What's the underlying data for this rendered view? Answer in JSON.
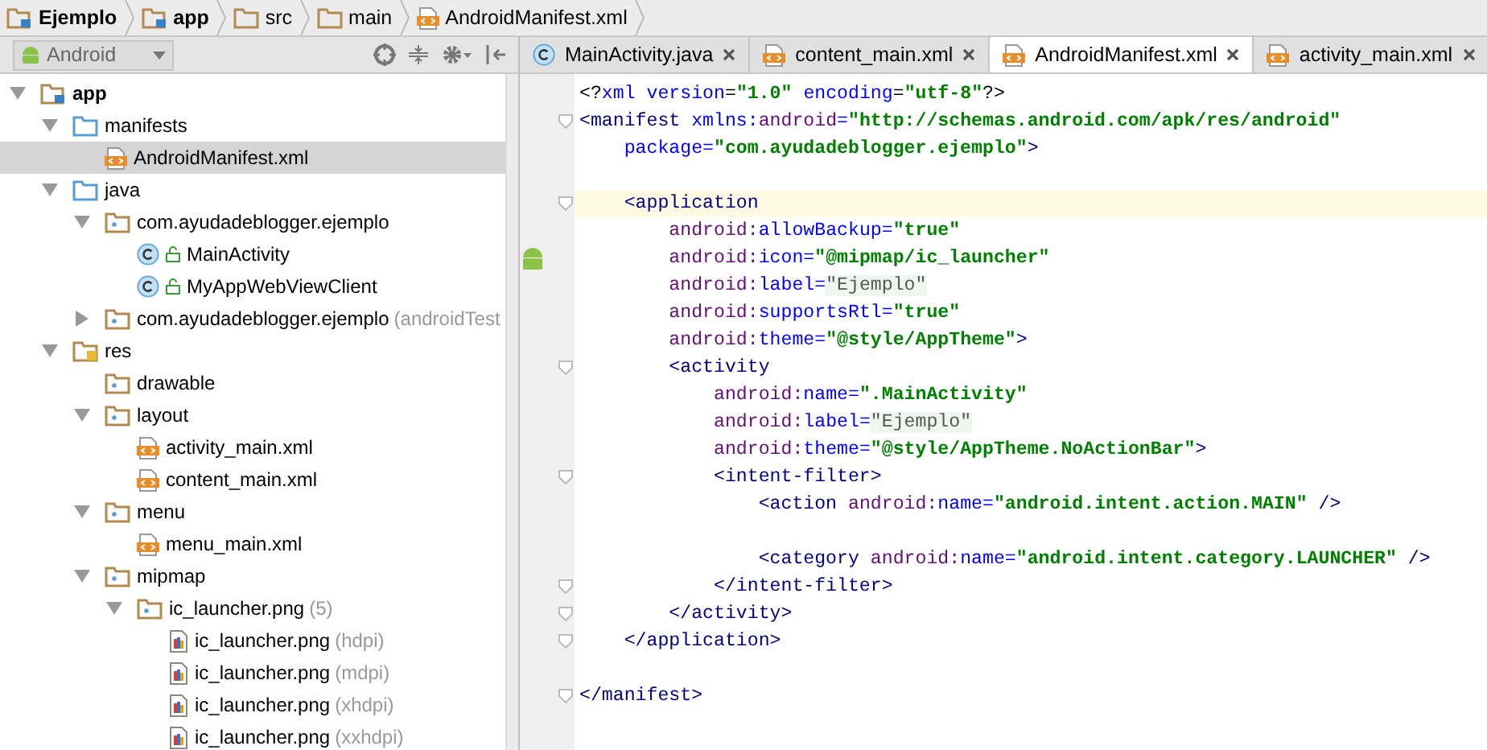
{
  "breadcrumbs": [
    {
      "label": "Ejemplo",
      "kind": "module"
    },
    {
      "label": "app",
      "kind": "module"
    },
    {
      "label": "src",
      "kind": "folder"
    },
    {
      "label": "main",
      "kind": "folder"
    },
    {
      "label": "AndroidManifest.xml",
      "kind": "xml"
    }
  ],
  "project_view": {
    "selector": "Android"
  },
  "tree": [
    {
      "label": "app",
      "kind": "module",
      "expanded": true,
      "selected": false,
      "children": [
        {
          "label": "manifests",
          "kind": "source-folder",
          "expanded": true,
          "selected": false,
          "children": [
            {
              "label": "AndroidManifest.xml",
              "kind": "xml",
              "selected": true
            }
          ]
        },
        {
          "label": "java",
          "kind": "source-folder",
          "expanded": true,
          "selected": false,
          "children": [
            {
              "label": "com.ayudadeblogger.ejemplo",
              "kind": "package",
              "expanded": true,
              "selected": false,
              "children": [
                {
                  "label": "MainActivity",
                  "kind": "class",
                  "selected": false
                },
                {
                  "label": "MyAppWebViewClient",
                  "kind": "class",
                  "selected": false
                }
              ]
            },
            {
              "label": "com.ayudadeblogger.ejemplo",
              "hint": "(androidTest",
              "kind": "package",
              "expanded": false,
              "selected": false
            }
          ]
        },
        {
          "label": "res",
          "kind": "res",
          "expanded": true,
          "selected": false,
          "children": [
            {
              "label": "drawable",
              "kind": "package",
              "selected": false
            },
            {
              "label": "layout",
              "kind": "package",
              "expanded": true,
              "selected": false,
              "children": [
                {
                  "label": "activity_main.xml",
                  "kind": "xml",
                  "selected": false
                },
                {
                  "label": "content_main.xml",
                  "kind": "xml",
                  "selected": false
                }
              ]
            },
            {
              "label": "menu",
              "kind": "package",
              "expanded": true,
              "selected": false,
              "children": [
                {
                  "label": "menu_main.xml",
                  "kind": "xml",
                  "selected": false
                }
              ]
            },
            {
              "label": "mipmap",
              "kind": "package",
              "expanded": true,
              "selected": false,
              "children": [
                {
                  "label": "ic_launcher.png",
                  "hint": "(5)",
                  "kind": "package",
                  "expanded": true,
                  "selected": false,
                  "children": [
                    {
                      "label": "ic_launcher.png",
                      "hint": "(hdpi)",
                      "kind": "image",
                      "selected": false
                    },
                    {
                      "label": "ic_launcher.png",
                      "hint": "(mdpi)",
                      "kind": "image",
                      "selected": false
                    },
                    {
                      "label": "ic_launcher.png",
                      "hint": "(xhdpi)",
                      "kind": "image",
                      "selected": false
                    },
                    {
                      "label": "ic_launcher.png",
                      "hint": "(xxhdpi)",
                      "kind": "image",
                      "selected": false
                    }
                  ]
                }
              ]
            }
          ]
        }
      ]
    }
  ],
  "tabs": [
    {
      "label": "MainActivity.java",
      "kind": "class",
      "selected": false
    },
    {
      "label": "content_main.xml",
      "kind": "xml",
      "selected": false
    },
    {
      "label": "AndroidManifest.xml",
      "kind": "xml",
      "selected": true
    },
    {
      "label": "activity_main.xml",
      "kind": "xml",
      "selected": false
    }
  ],
  "code_lines": [
    {
      "current": false,
      "kind": "plain",
      "tokens": [
        {
          "kind": "punct",
          "text": "<?"
        },
        {
          "kind": "attr",
          "text": "xml "
        },
        {
          "kind": "attr",
          "text": "version"
        },
        {
          "kind": "punct",
          "text": "="
        },
        {
          "kind": "value",
          "text": "\"1.0\" "
        },
        {
          "kind": "attr",
          "text": "encoding"
        },
        {
          "kind": "punct",
          "text": "="
        },
        {
          "kind": "value",
          "text": "\"utf-8\""
        },
        {
          "kind": "punct",
          "text": "?>"
        }
      ]
    },
    {
      "current": false,
      "kind": "fold",
      "tokens": [
        {
          "kind": "tag",
          "text": "<manifest "
        },
        {
          "kind": "attr",
          "text": "xmlns:"
        },
        {
          "kind": "ns",
          "text": "android"
        },
        {
          "kind": "attr",
          "text": "="
        },
        {
          "kind": "value",
          "text": "\"http://schemas.android.com/apk/res/android\""
        }
      ]
    },
    {
      "current": false,
      "kind": "plain",
      "tokens": [
        {
          "kind": "attr",
          "text": "    package"
        },
        {
          "kind": "attr",
          "text": "="
        },
        {
          "kind": "value",
          "text": "\"com.ayudadeblogger.ejemplo\""
        },
        {
          "kind": "tag",
          "text": ">"
        }
      ]
    },
    {
      "current": false,
      "kind": "plain"
    },
    {
      "current": true,
      "kind": "fold",
      "tokens": [
        {
          "kind": "tag",
          "text": "    <application"
        }
      ]
    },
    {
      "current": false,
      "kind": "plain",
      "tokens": [
        {
          "kind": "ns",
          "text": "        android:"
        },
        {
          "kind": "attr",
          "text": "allowBackup"
        },
        {
          "kind": "attr",
          "text": "="
        },
        {
          "kind": "value",
          "text": "\"true\""
        }
      ]
    },
    {
      "current": false,
      "kind": "android",
      "tokens": [
        {
          "kind": "ns",
          "text": "        android:"
        },
        {
          "kind": "attr",
          "text": "icon"
        },
        {
          "kind": "attr",
          "text": "="
        },
        {
          "kind": "value",
          "text": "\"@mipmap/ic_launcher\""
        }
      ]
    },
    {
      "current": false,
      "kind": "plain",
      "tokens": [
        {
          "kind": "ns",
          "text": "        android:"
        },
        {
          "kind": "attr",
          "text": "label"
        },
        {
          "kind": "attr",
          "text": "="
        },
        {
          "kind": "folded",
          "text": "\"Ejemplo\""
        }
      ]
    },
    {
      "current": false,
      "kind": "plain",
      "tokens": [
        {
          "kind": "ns",
          "text": "        android:"
        },
        {
          "kind": "attr",
          "text": "supportsRtl"
        },
        {
          "kind": "attr",
          "text": "="
        },
        {
          "kind": "value",
          "text": "\"true\""
        }
      ]
    },
    {
      "current": false,
      "kind": "plain",
      "tokens": [
        {
          "kind": "ns",
          "text": "        android:"
        },
        {
          "kind": "attr",
          "text": "theme"
        },
        {
          "kind": "attr",
          "text": "="
        },
        {
          "kind": "value",
          "text": "\"@style/AppTheme\""
        },
        {
          "kind": "tag",
          "text": ">"
        }
      ]
    },
    {
      "current": false,
      "kind": "fold",
      "tokens": [
        {
          "kind": "tag",
          "text": "        <activity"
        }
      ]
    },
    {
      "current": false,
      "kind": "plain",
      "tokens": [
        {
          "kind": "ns",
          "text": "            android:"
        },
        {
          "kind": "attr",
          "text": "name"
        },
        {
          "kind": "attr",
          "text": "="
        },
        {
          "kind": "value",
          "text": "\".MainActivity\""
        }
      ]
    },
    {
      "current": false,
      "kind": "plain",
      "tokens": [
        {
          "kind": "ns",
          "text": "            android:"
        },
        {
          "kind": "attr",
          "text": "label"
        },
        {
          "kind": "attr",
          "text": "="
        },
        {
          "kind": "folded",
          "text": "\"Ejemplo\""
        }
      ]
    },
    {
      "current": false,
      "kind": "plain",
      "tokens": [
        {
          "kind": "ns",
          "text": "            android:"
        },
        {
          "kind": "attr",
          "text": "theme"
        },
        {
          "kind": "attr",
          "text": "="
        },
        {
          "kind": "value",
          "text": "\"@style/AppTheme.NoActionBar\""
        },
        {
          "kind": "tag",
          "text": ">"
        }
      ]
    },
    {
      "current": false,
      "kind": "fold",
      "tokens": [
        {
          "kind": "tag",
          "text": "            <intent-filter>"
        }
      ]
    },
    {
      "current": false,
      "kind": "plain",
      "tokens": [
        {
          "kind": "tag",
          "text": "                <action "
        },
        {
          "kind": "ns",
          "text": "android:"
        },
        {
          "kind": "attr",
          "text": "name"
        },
        {
          "kind": "attr",
          "text": "="
        },
        {
          "kind": "value",
          "text": "\"android.intent.action.MAIN\" "
        },
        {
          "kind": "tag",
          "text": "/>"
        }
      ]
    },
    {
      "current": false,
      "kind": "plain"
    },
    {
      "current": false,
      "kind": "plain",
      "tokens": [
        {
          "kind": "tag",
          "text": "                <category "
        },
        {
          "kind": "ns",
          "text": "android:"
        },
        {
          "kind": "attr",
          "text": "name"
        },
        {
          "kind": "attr",
          "text": "="
        },
        {
          "kind": "value",
          "text": "\"android.intent.category.LAUNCHER\" "
        },
        {
          "kind": "tag",
          "text": "/>"
        }
      ]
    },
    {
      "current": false,
      "kind": "fold",
      "tokens": [
        {
          "kind": "tag",
          "text": "            </intent-filter>"
        }
      ]
    },
    {
      "current": false,
      "kind": "fold",
      "tokens": [
        {
          "kind": "tag",
          "text": "        </activity>"
        }
      ]
    },
    {
      "current": false,
      "kind": "fold",
      "tokens": [
        {
          "kind": "tag",
          "text": "    </application>"
        }
      ]
    },
    {
      "current": false,
      "kind": "plain"
    },
    {
      "current": false,
      "kind": "fold",
      "tokens": [
        {
          "kind": "tag",
          "text": "</manifest>"
        }
      ]
    }
  ]
}
